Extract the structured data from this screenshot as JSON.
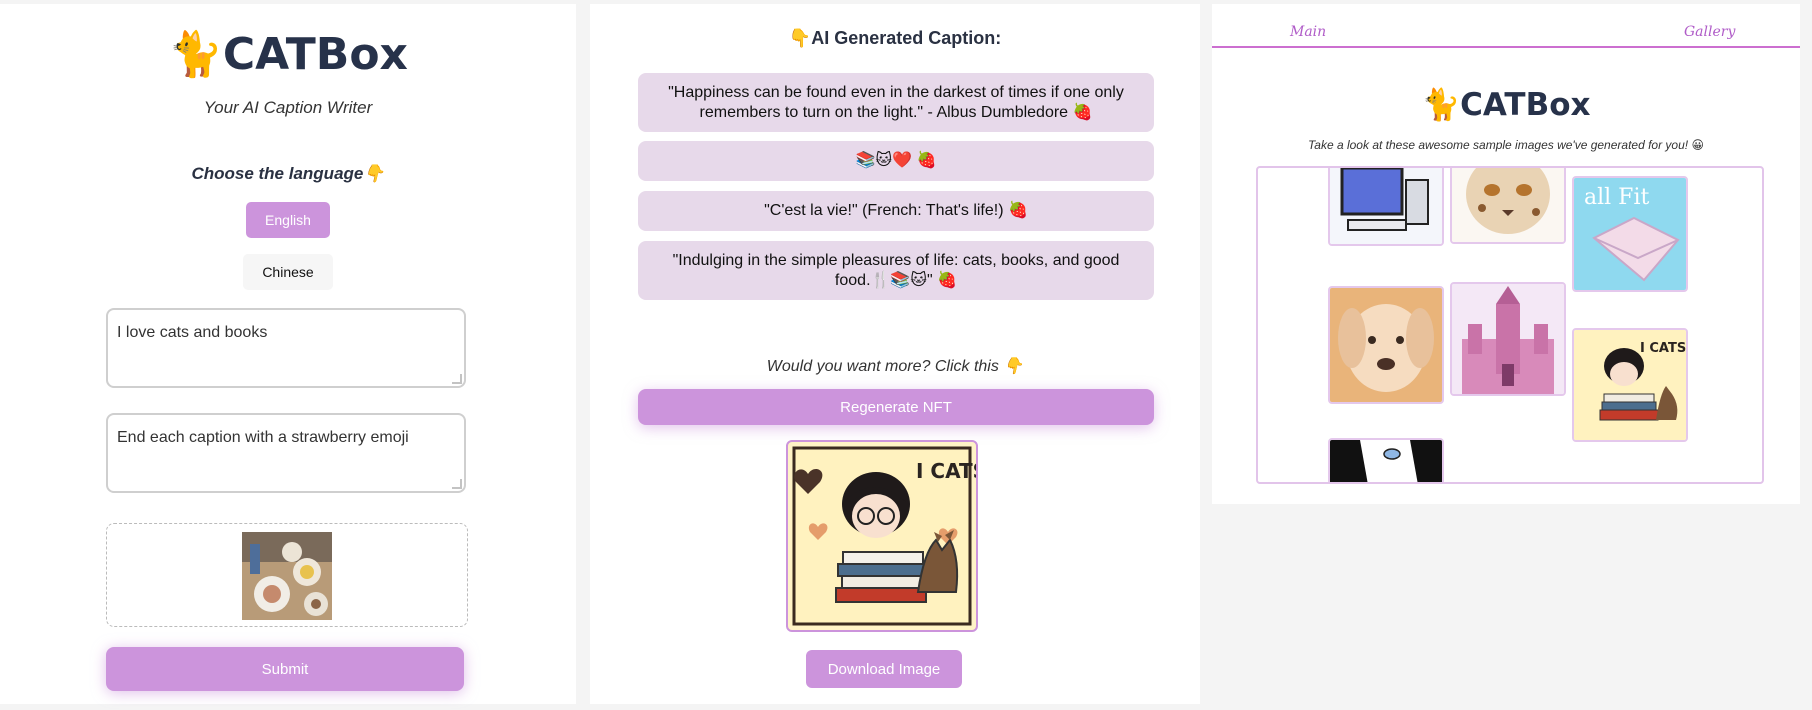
{
  "brand": {
    "emoji": "🐈",
    "name": "CATBox"
  },
  "main": {
    "tagline": "Your AI Caption Writer",
    "language_prompt": "Choose the language👇",
    "languages": [
      "English",
      "Chinese"
    ],
    "selected_language": "English",
    "prompt_value": "I love cats and books",
    "instruction_value": "End each caption with a strawberry emoji",
    "submit_label": "Submit"
  },
  "results": {
    "title": "👇AI Generated Caption:",
    "captions": [
      "\"Happiness can be found even in the darkest of times if one only remembers to turn on the light.\" - Albus Dumbledore 🍓",
      "📚🐱❤️ 🍓",
      "\"C'est la vie!\" (French: That's life!) 🍓",
      "\"Indulging in the simple pleasures of life: cats, books, and good food.🍴📚🐱\" 🍓"
    ],
    "more_prompt": "Would you want more? Click this 👇",
    "regenerate_label": "Regenerate NFT",
    "nft_text": "I CATS",
    "download_label": "Download Image"
  },
  "gallery_page": {
    "nav": {
      "main": "Main",
      "gallery": "Gallery"
    },
    "note": "Take a look at these awesome sample images we've generated for you! 😀",
    "sample_texts": [
      "all Fit",
      "I CATS"
    ]
  },
  "colors": {
    "accent": "#cc94dc",
    "caption_bg": "#e7d9ea",
    "title": "#27324a",
    "nav": "#b05cc8"
  }
}
